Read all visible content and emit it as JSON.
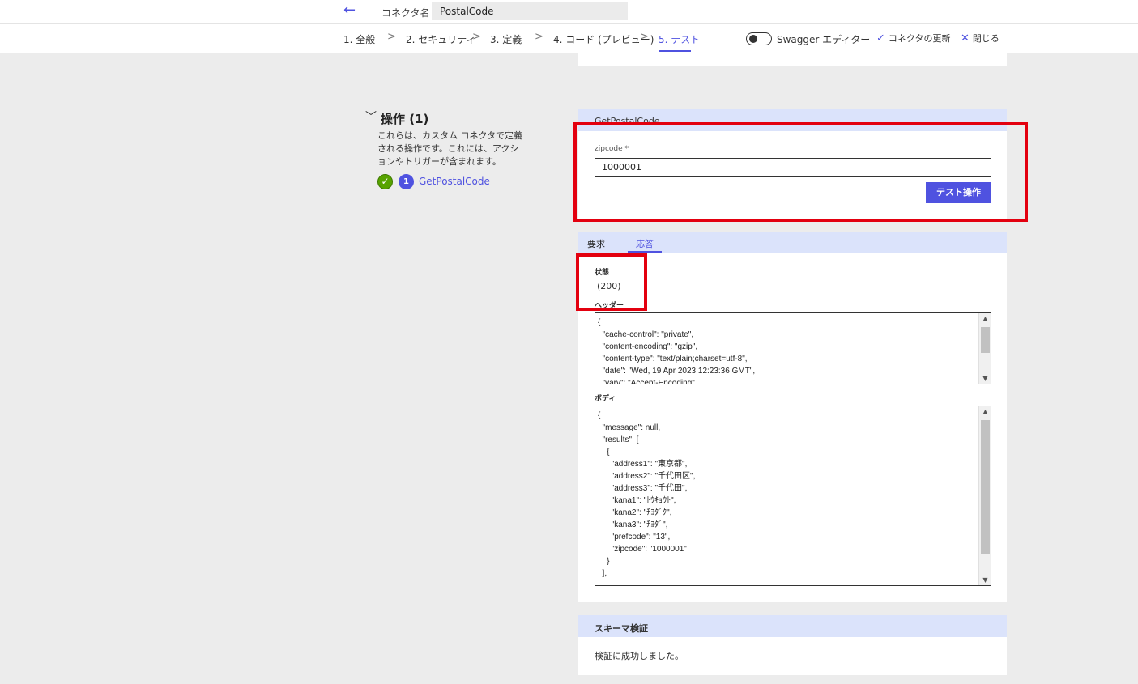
{
  "header": {
    "back_icon": "←",
    "connector_label": "コネクタ名",
    "connector_name": "PostalCode"
  },
  "steps": [
    {
      "label": "1. 全般"
    },
    {
      "label": "2. セキュリティ"
    },
    {
      "label": "3. 定義"
    },
    {
      "label": "4. コード (プレビュー)"
    },
    {
      "label": "5. テスト"
    }
  ],
  "step_separator": ">",
  "toolbar": {
    "swagger_label": "Swagger エディター",
    "update_label": "コネクタの更新",
    "close_label": "閉じる",
    "check_icon": "✓",
    "close_icon": "✕"
  },
  "operations": {
    "chevron": "﹀",
    "title": "操作 (1)",
    "description": "これらは、カスタム コネクタで定義される操作です。これには、アクションやトリガーが含まれます。",
    "check_icon": "✓",
    "badge": "1",
    "operation_name": "GetPostalCode"
  },
  "test_card": {
    "title": "GetPostalCode",
    "zipcode_label": "zipcode *",
    "zipcode_value": "1000001",
    "test_button": "テスト操作"
  },
  "response": {
    "tab_request": "要求",
    "tab_response": "応答",
    "status_label": "状態",
    "status_value": "(200)",
    "headers_label": "ヘッダー",
    "headers_text": "{\n  \"cache-control\": \"private\",\n  \"content-encoding\": \"gzip\",\n  \"content-type\": \"text/plain;charset=utf-8\",\n  \"date\": \"Wed, 19 Apr 2023 12:23:36 GMT\",\n  \"vary\": \"Accept-Encoding\"",
    "body_label": "ボディ",
    "body_text": "{\n  \"message\": null,\n  \"results\": [\n    {\n      \"address1\": \"東京都\",\n      \"address2\": \"千代田区\",\n      \"address3\": \"千代田\",\n      \"kana1\": \"ﾄｳｷｮｳﾄ\",\n      \"kana2\": \"ﾁﾖﾀﾞｸ\",\n      \"kana3\": \"ﾁﾖﾀﾞ\",\n      \"prefcode\": \"13\",\n      \"zipcode\": \"1000001\"\n    }\n  ],"
  },
  "schema": {
    "title": "スキーマ検証",
    "message": "検証に成功しました。"
  },
  "colors": {
    "accent": "#4f52e0",
    "highlight": "#e3000f",
    "success": "#57a300"
  }
}
